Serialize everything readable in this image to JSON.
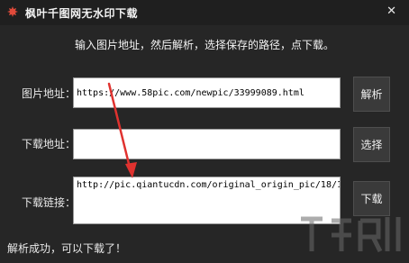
{
  "window": {
    "title": "枫叶千图网无水印下载",
    "close_glyph": "✕"
  },
  "instruction": "输入图片地址，然后解析，选择保存的路径，点下载。",
  "rows": {
    "image_url": {
      "label": "图片地址：",
      "value": "https://www.58pic.com/newpic/33999089.html",
      "button": "解析"
    },
    "download_path": {
      "label": "下载地址：",
      "value": "",
      "button": "选择"
    },
    "download_link": {
      "label": "下载链接：",
      "value": "http://pic.qiantucdn.com/original_origin_pic/18/1",
      "button": "下载"
    }
  },
  "status": "解析成功，可以下载了！",
  "colors": {
    "annotation_arrow": "#e0322f",
    "app_icon": "#e04a3a"
  },
  "icons": {
    "app": "maple-leaf-icon",
    "close": "close-icon",
    "watermark": "site-watermark-logo"
  }
}
